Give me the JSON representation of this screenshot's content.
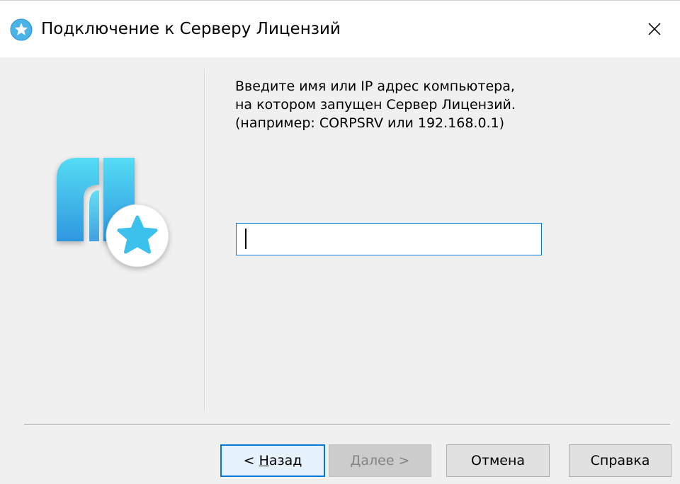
{
  "window": {
    "title": "Подключение к Серверу Лицензий",
    "title_icon": "star-badge-icon",
    "close_icon": "close-icon"
  },
  "logo": {
    "icon": "app-logo-star-icon"
  },
  "prompt": {
    "line1": "Введите имя или IP адрес компьютера,",
    "line2": "на котором запущен Сервер Лицензий.",
    "line3": "(например: CORPSRV или 192.168.0.1)"
  },
  "host_input": {
    "value": "",
    "placeholder": ""
  },
  "buttons": {
    "back_prefix": "< ",
    "back_mnemonic": "Н",
    "back_rest": "азад",
    "next_mnemonic": "Д",
    "next_rest": "алее >",
    "cancel": "Отмена",
    "help": "Справка"
  },
  "colors": {
    "accent": "#0078d7",
    "logo_gradient_top": "#4fd6f2",
    "logo_gradient_bottom": "#2f9be0",
    "star": "#3ec0ec",
    "dialog_background": "#f0f0f0"
  }
}
